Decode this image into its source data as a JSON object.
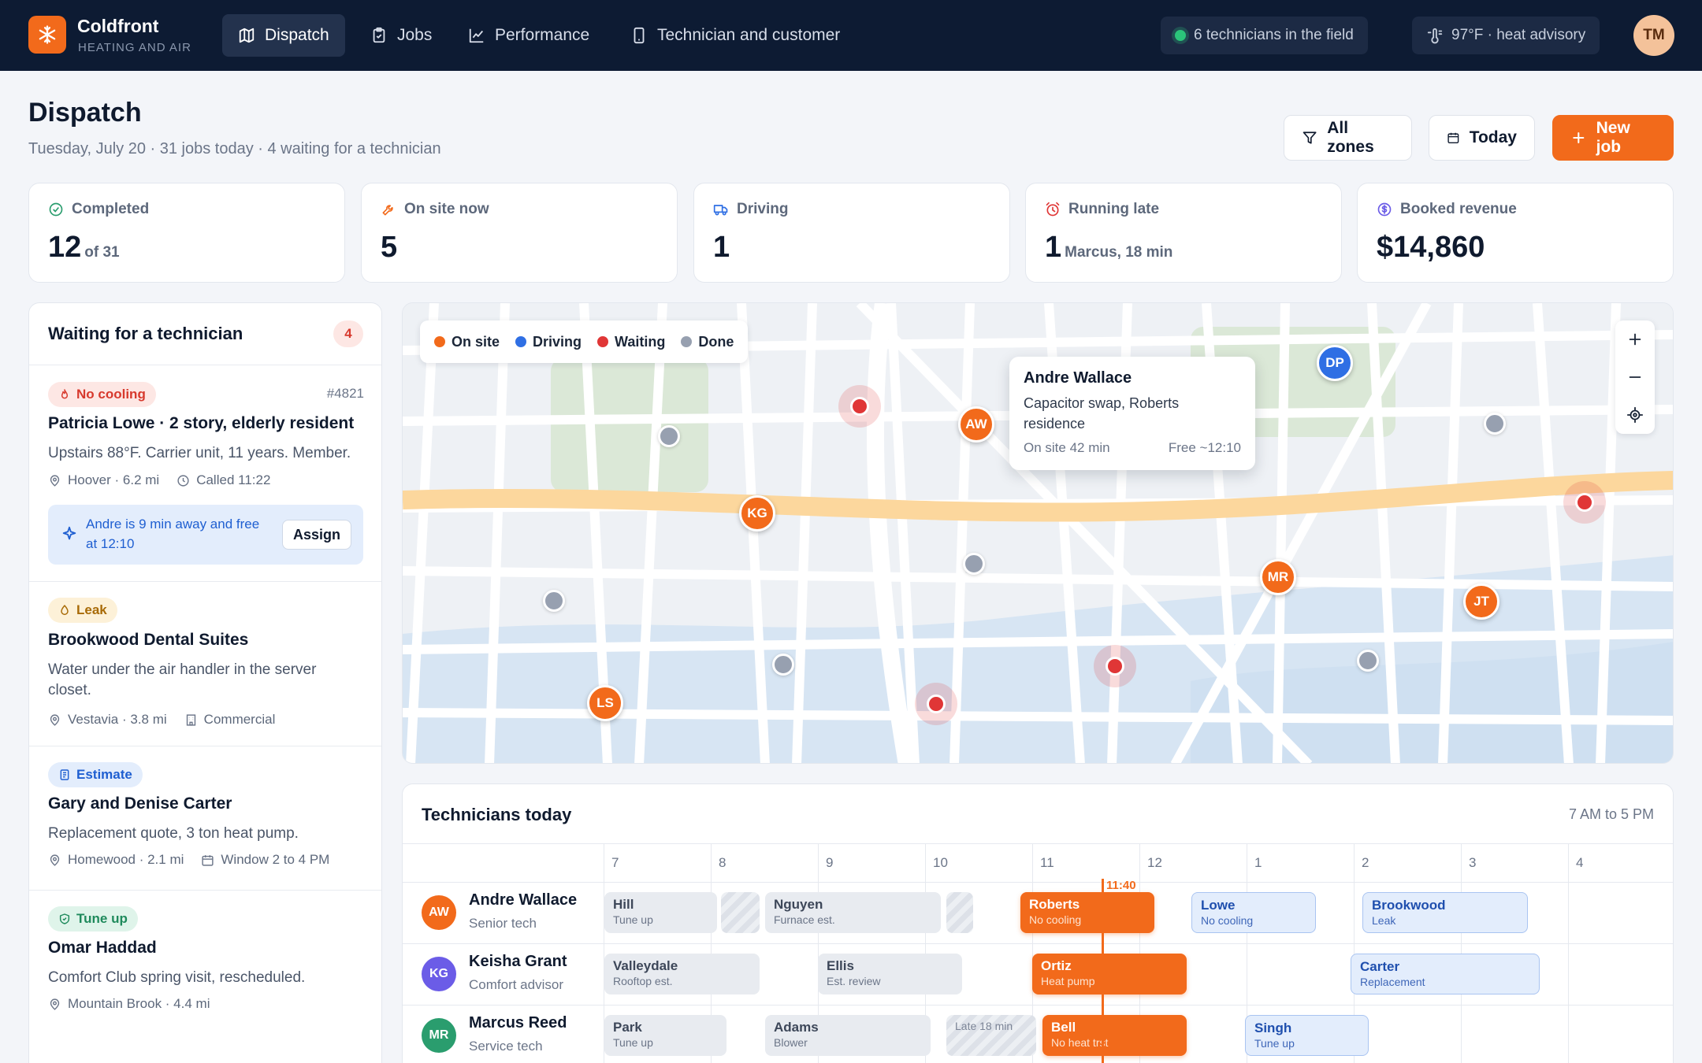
{
  "brand": {
    "name": "Coldfront",
    "subtitle": "HEATING AND AIR"
  },
  "nav": {
    "items": [
      {
        "label": "Dispatch",
        "icon": "map-icon",
        "active": true
      },
      {
        "label": "Jobs",
        "icon": "clipboard-icon"
      },
      {
        "label": "Performance",
        "icon": "chart-line-icon"
      },
      {
        "label": "Technician and customer",
        "icon": "phone-icon"
      }
    ],
    "field_status": "6 technicians in the field",
    "weather": "97°F · heat advisory",
    "user_initials": "TM"
  },
  "header": {
    "title": "Dispatch",
    "subtitle": "Tuesday, July 20 · 31 jobs today · 4 waiting for a technician",
    "zones_button": "All zones",
    "date_button": "Today",
    "new_job_button": "New job"
  },
  "stats": [
    {
      "label": "Completed",
      "value": "12",
      "suffix": "of 31",
      "icon": "check-circle-icon",
      "color": "#2a9d6e"
    },
    {
      "label": "On site now",
      "value": "5",
      "suffix": "",
      "icon": "wrench-icon",
      "color": "#f26a1b"
    },
    {
      "label": "Driving",
      "value": "1",
      "suffix": "",
      "icon": "truck-icon",
      "color": "#2f6fe4"
    },
    {
      "label": "Running late",
      "value": "1",
      "suffix": "Marcus, 18 min",
      "icon": "alarm-icon",
      "color": "#e03636"
    },
    {
      "label": "Booked revenue",
      "value": "$14,860",
      "suffix": "",
      "icon": "dollar-icon",
      "color": "#6b5ce7"
    }
  ],
  "waiting": {
    "title": "Waiting for a technician",
    "count": "4",
    "jobs": [
      {
        "tag": "No cooling",
        "tag_icon": "flame-icon",
        "id": "#4821",
        "title": "Patricia Lowe · 2 story, elderly resident",
        "desc": "Upstairs 88°F. Carrier unit, 11 years. Member.",
        "meta1": "Hoover · 6.2 mi",
        "meta2": "Called 11:22",
        "suggestion": "Andre is 9 min away and free at 12:10",
        "assign": "Assign"
      },
      {
        "tag": "Leak",
        "tag_icon": "drop-icon",
        "title": "Brookwood Dental Suites",
        "desc": "Water under the air handler in the server closet.",
        "meta1": "Vestavia · 3.8 mi",
        "meta2": "Commercial"
      },
      {
        "tag": "Estimate",
        "tag_icon": "document-icon",
        "title": "Gary and Denise Carter",
        "desc": "Replacement quote, 3 ton heat pump.",
        "meta1": "Homewood · 2.1 mi",
        "meta2": "Window 2 to 4 PM"
      },
      {
        "tag": "Tune up",
        "tag_icon": "shield-icon",
        "title": "Omar Haddad",
        "desc": "Comfort Club spring visit, rescheduled.",
        "meta1": "Mountain Brook · 4.4 mi"
      }
    ]
  },
  "map": {
    "legend": [
      "On site",
      "Driving",
      "Waiting",
      "Done"
    ],
    "legend_colors": [
      "#f26a1b",
      "#2f6fe4",
      "#e03636",
      "#97a0b0"
    ],
    "technicians": [
      "AW",
      "KG",
      "MR",
      "JT",
      "LS",
      "DP"
    ],
    "popup": {
      "name": "Andre Wallace",
      "desc": "Capacitor swap, Roberts residence",
      "onsite": "On site 42 min",
      "free": "Free ~12:10"
    }
  },
  "timeline": {
    "title": "Technicians today",
    "range": "7 AM to 5 PM",
    "hours": [
      "7",
      "8",
      "9",
      "10",
      "11",
      "12",
      "1",
      "2",
      "3",
      "4"
    ],
    "now_label": "11:40",
    "late_label": "Late 18 min",
    "techs": [
      {
        "initials": "AW",
        "name": "Andre Wallace",
        "role": "Senior tech",
        "color": "#f26a1b",
        "jobs": [
          {
            "name": "Hill",
            "sub": "Tune up"
          },
          {
            "name": "Nguyen",
            "sub": "Furnace est."
          },
          {
            "name": "Roberts",
            "sub": "No cooling"
          },
          {
            "name": "Lowe",
            "sub": "No cooling"
          },
          {
            "name": "Brookwood",
            "sub": "Leak"
          }
        ]
      },
      {
        "initials": "KG",
        "name": "Keisha Grant",
        "role": "Comfort advisor",
        "color": "#6b5ce7",
        "jobs": [
          {
            "name": "Valleydale",
            "sub": "Rooftop est."
          },
          {
            "name": "Ellis",
            "sub": "Est. review"
          },
          {
            "name": "Ortiz",
            "sub": "Heat pump"
          },
          {
            "name": "Carter",
            "sub": "Replacement"
          }
        ]
      },
      {
        "initials": "MR",
        "name": "Marcus Reed",
        "role": "Service tech",
        "color": "#2a9d6e",
        "jobs": [
          {
            "name": "Park",
            "sub": "Tune up"
          },
          {
            "name": "Adams",
            "sub": "Blower"
          },
          {
            "name": "Bell",
            "sub": "No heat trst"
          },
          {
            "name": "Singh",
            "sub": "Tune up"
          }
        ]
      }
    ]
  }
}
